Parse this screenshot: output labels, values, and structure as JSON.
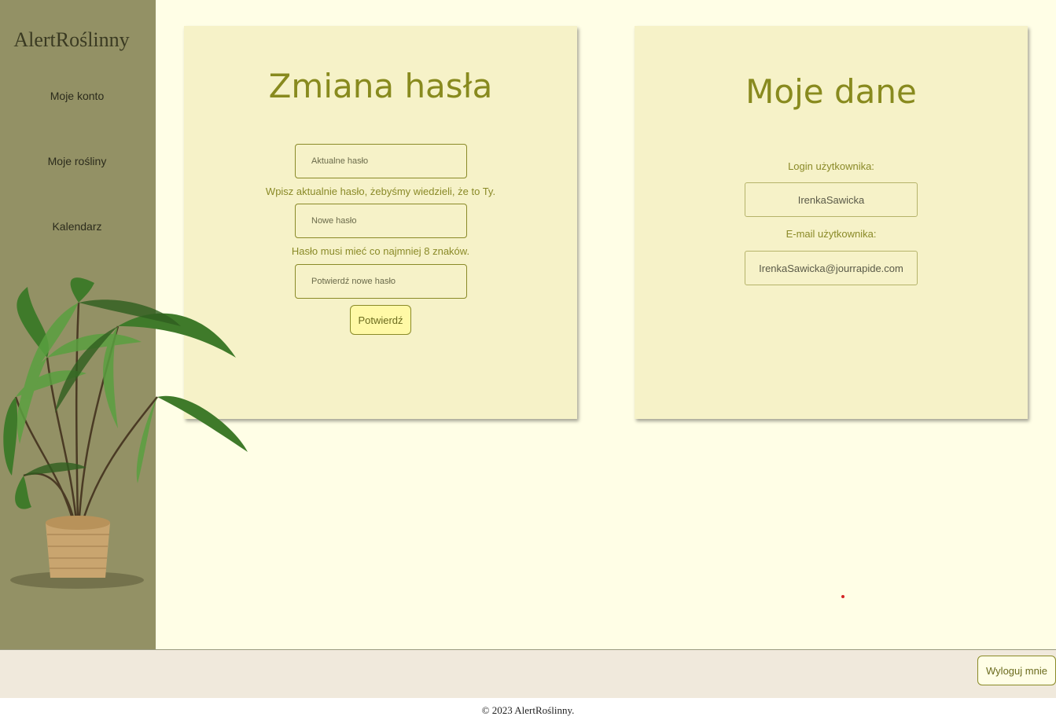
{
  "app": {
    "logo": "AlertRoślinny"
  },
  "sidebar": {
    "items": [
      {
        "label": "Moje konto"
      },
      {
        "label": "Moje rośliny"
      },
      {
        "label": "Kalendarz"
      }
    ]
  },
  "password_card": {
    "title": "Zmiana hasła",
    "current_placeholder": "Aktualne hasło",
    "current_hint": "Wpisz aktualnie hasło, żebyśmy wiedzieli, że to Ty.",
    "new_placeholder": "Nowe hasło",
    "new_hint": "Hasło musi mieć co najmniej 8 znaków.",
    "confirm_placeholder": "Potwierdź nowe hasło",
    "confirm_button": "Potwierdź"
  },
  "data_card": {
    "title": "Moje dane",
    "login_label": "Login użytkownika:",
    "login_value": "IrenkaSawicka",
    "email_label": "E-mail użytkownika:",
    "email_value": "IrenkaSawicka@jourrapide.com"
  },
  "footer": {
    "logout_button": "Wyloguj mnie",
    "copyright": "© 2023 AlertRoślinny."
  },
  "colors": {
    "sidebar_bg": "#939165",
    "main_bg": "#fffee6",
    "card_bg": "#f6f2c8",
    "accent": "#888a1e"
  }
}
